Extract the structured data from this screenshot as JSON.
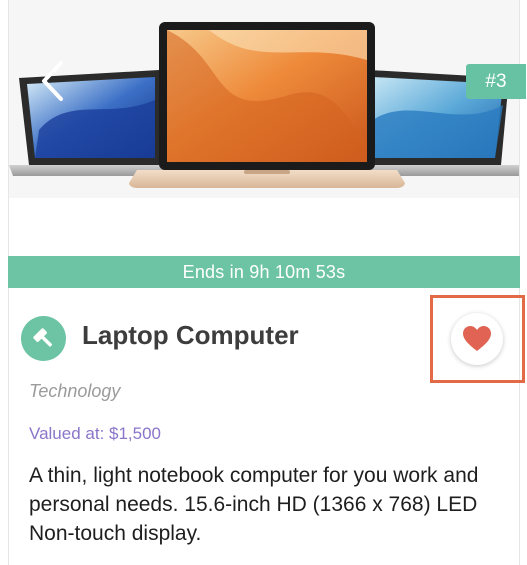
{
  "hero": {
    "image_subject": "laptop-computer-photo",
    "back_icon": "chevron-left-icon",
    "rank_badge": "#3"
  },
  "timer": {
    "text": "Ends in 9h 10m 53s"
  },
  "item": {
    "category_icon": "gavel-icon",
    "title": "Laptop Computer",
    "favorite_icon": "heart-icon",
    "category": "Technology",
    "value_text": "Valued at: $1,500",
    "description": "A thin, light notebook computer for you work and personal needs. 15.6-inch HD (1366 x 768) LED Non-touch display."
  },
  "colors": {
    "accent": "#6cc4a4",
    "heart": "#e06353",
    "highlight_border": "#e26a46",
    "value_text": "#8a75c9",
    "category_text": "#9b9b9b"
  }
}
